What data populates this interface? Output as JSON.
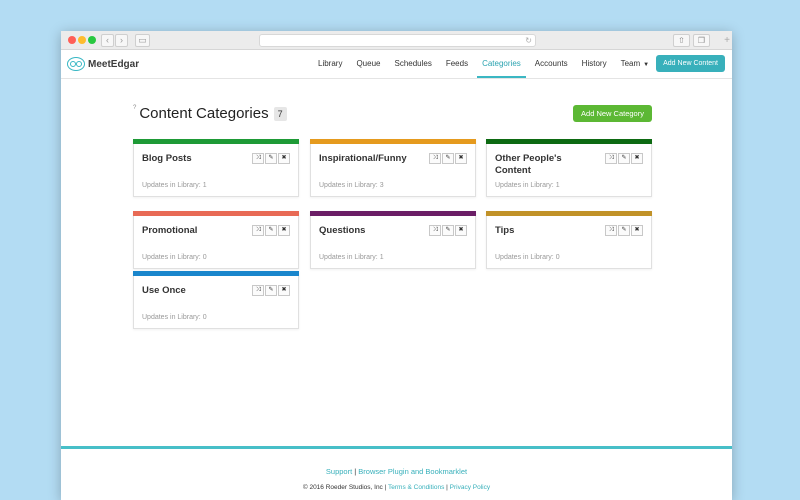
{
  "browser": {
    "back_icon": "chevron-left-icon",
    "forward_icon": "chevron-right-icon",
    "sidebar_icon": "sidebar-icon",
    "reload_icon": "reload-icon",
    "share_icon": "share-icon",
    "tabs_icon": "tabs-icon",
    "new_tab_icon": "plus-icon"
  },
  "nav": {
    "logo_text": "MeetEdgar",
    "links": [
      "Library",
      "Queue",
      "Schedules",
      "Feeds",
      "Categories",
      "Accounts",
      "History",
      "Team"
    ],
    "active": "Categories",
    "add_content_label": "Add New Content"
  },
  "page": {
    "title": "Content Categories",
    "count": "7",
    "add_category_label": "Add New Category"
  },
  "categories": [
    {
      "name": "Blog Posts",
      "updates": "Updates in Library: 1",
      "color": "#1e9a36"
    },
    {
      "name": "Inspirational/Funny",
      "updates": "Updates in Library: 3",
      "color": "#e59a1e"
    },
    {
      "name": "Other People's Content",
      "updates": "Updates in Library: 1",
      "color": "#0d6a12"
    },
    {
      "name": "Promotional",
      "updates": "Updates in Library: 0",
      "color": "#e86a55"
    },
    {
      "name": "Questions",
      "updates": "Updates in Library: 1",
      "color": "#6b1e66"
    },
    {
      "name": "Tips",
      "updates": "Updates in Library: 0",
      "color": "#c19228"
    },
    {
      "name": "Use Once",
      "updates": "Updates in Library: 0",
      "color": "#1a86cc"
    }
  ],
  "card_actions": {
    "shuffle_icon": "shuffle-icon",
    "edit_icon": "pencil-icon",
    "delete_icon": "close-icon"
  },
  "footer": {
    "support": "Support",
    "plugin": "Browser Plugin and Bookmarklet",
    "copyright": "© 2016 Roeder Studios, Inc",
    "terms": "Terms & Conditions",
    "privacy": "Privacy Policy"
  },
  "colors": {
    "accent": "#38b0bb",
    "green_button": "#5cb834"
  }
}
